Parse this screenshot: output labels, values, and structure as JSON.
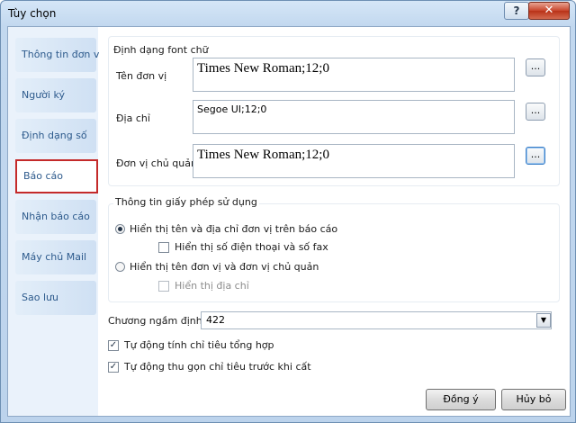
{
  "window": {
    "title": "Tùy chọn",
    "help_glyph": "?",
    "close_glyph": "✕"
  },
  "sidebar": {
    "items": [
      {
        "label": "Thông tin đơn vị"
      },
      {
        "label": "Người ký"
      },
      {
        "label": "Định dạng số"
      },
      {
        "label": "Báo cáo"
      },
      {
        "label": "Nhận báo cáo"
      },
      {
        "label": "Máy chủ Mail"
      },
      {
        "label": "Sao lưu"
      }
    ],
    "selected": "Báo cáo"
  },
  "font_group": {
    "title": "Định dạng font chữ",
    "rows": [
      {
        "label": "Tên đơn vị",
        "value": "Times New Roman;12;0",
        "button": "..."
      },
      {
        "label": "Địa chỉ",
        "value": "Segoe UI;12;0",
        "button": "..."
      },
      {
        "label": "Đơn vị chủ quản",
        "value": "Times New Roman;12;0",
        "button": "..."
      }
    ]
  },
  "license_group": {
    "title": "Thông tin giấy phép sử dụng",
    "option1": {
      "label": "Hiển thị tên và địa chỉ đơn vị trên báo cáo",
      "selected": true
    },
    "option1_sub": {
      "label": "Hiển thị số điện thoại và số fax",
      "checked": false
    },
    "option2": {
      "label": "Hiển thị tên đơn vị và đơn vị chủ quản",
      "selected": false
    },
    "option2_sub": {
      "label": "Hiển thị địa chỉ",
      "checked": false,
      "disabled": true
    }
  },
  "program": {
    "label": "Chương ngầm định",
    "value": "422"
  },
  "checks": [
    {
      "label": "Tự động tính chỉ tiêu tổng hợp",
      "checked": true
    },
    {
      "label": "Tự động thu gọn chỉ tiêu trước khi cất",
      "checked": true
    }
  ],
  "buttons": {
    "ok": "Đồng ý",
    "cancel": "Hủy bỏ"
  },
  "check_glyph": "✓",
  "dropdown_glyph": "▼"
}
